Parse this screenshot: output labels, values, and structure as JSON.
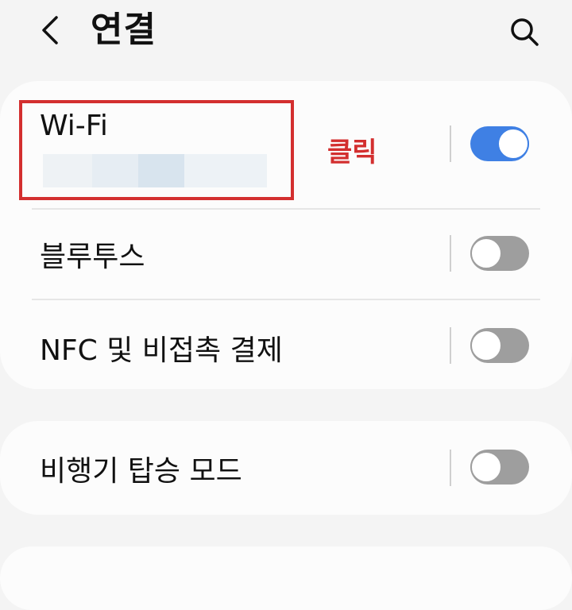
{
  "header": {
    "title": "연결",
    "back_icon": "chevron-left-icon",
    "search_icon": "search-icon"
  },
  "settings": {
    "wifi": {
      "label": "Wi-Fi",
      "network_name_redacted": true,
      "toggle_on": true
    },
    "bluetooth": {
      "label": "블루투스",
      "toggle_on": false
    },
    "nfc": {
      "label": "NFC 및 비접촉 결제",
      "toggle_on": false
    },
    "airplane": {
      "label": "비행기 탑승 모드",
      "toggle_on": false
    }
  },
  "annotation": {
    "click_text": "클릭",
    "color": "#d32f2f"
  },
  "colors": {
    "background": "#f4f4f4",
    "card": "#fcfcfc",
    "toggle_on": "#3f80e4",
    "toggle_off": "#9e9e9e"
  }
}
